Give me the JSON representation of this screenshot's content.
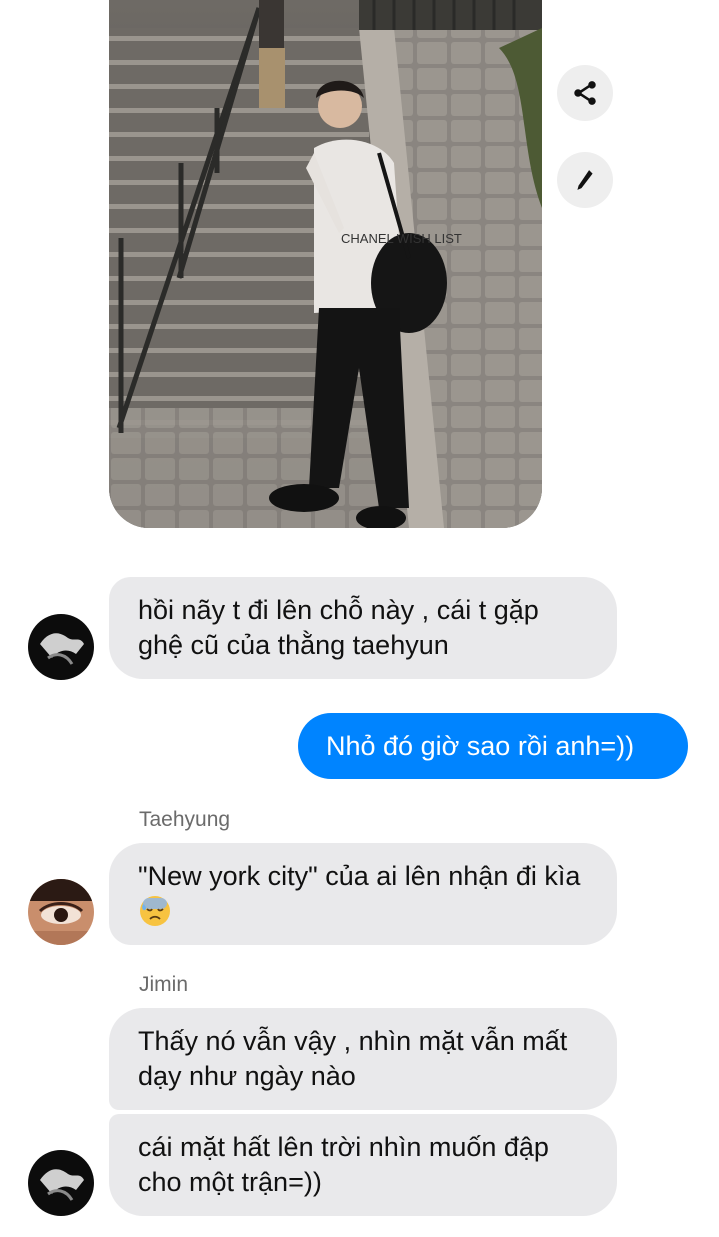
{
  "shared_photo": {
    "shirt_text": "CHANEL WISH LIST"
  },
  "actions": {
    "share_icon": "share-icon",
    "edit_icon": "pencil-icon"
  },
  "messages": [
    {
      "direction": "incoming",
      "sender_name": "",
      "avatar": "avatar-hand-gesture",
      "text": "hồi nãy t đi lên chỗ này , cái t gặp ghệ cũ của thằng taehyun"
    },
    {
      "direction": "outgoing",
      "text": "Nhỏ đó giờ sao rồi anh=))"
    },
    {
      "direction": "incoming",
      "sender_name": "Taehyung",
      "avatar": "avatar-eye-closeup",
      "text": "\"New york city\" của ai lên nhận đi kìa",
      "emoji": "downcast-face-with-sweat"
    },
    {
      "direction": "incoming",
      "sender_name": "Jimin",
      "avatar": "avatar-hand-gesture",
      "text": "Thấy nó vẫn vậy , nhìn mặt vẫn mất dạy như ngày nào"
    },
    {
      "direction": "incoming",
      "sender_name": "",
      "avatar": "avatar-hand-gesture",
      "text": "cái mặt hất lên trời nhìn muốn đập cho một trận=))"
    }
  ],
  "colors": {
    "incoming_bubble": "#e9e9eb",
    "outgoing_bubble": "#0084ff",
    "outgoing_text": "#ffffff",
    "sender_name": "#6b6b6b"
  }
}
